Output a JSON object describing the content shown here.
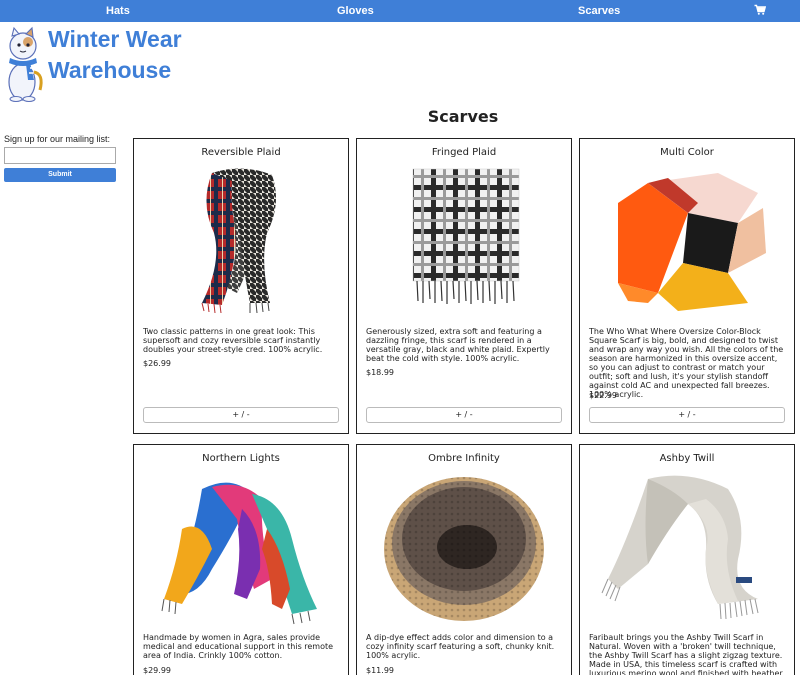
{
  "nav": {
    "items": [
      {
        "label": "Hats"
      },
      {
        "label": "Gloves"
      },
      {
        "label": "Scarves"
      }
    ],
    "cart_icon": "cart-icon",
    "color": "#3f7fd7"
  },
  "logo": {
    "line1": "Winter Wear",
    "line2": "Warehouse"
  },
  "signup": {
    "label": "Sign up for our mailing list:",
    "input_value": "",
    "submit_label": "Submit"
  },
  "page": {
    "title": "Scarves"
  },
  "products": [
    {
      "name": "Reversible Plaid",
      "description": "Two classic patterns in one great look: This supersoft and cozy reversible scarf instantly doubles your street-style cred. 100% acrylic.",
      "price": "$26.99",
      "qty_label": "+ / -"
    },
    {
      "name": "Fringed Plaid",
      "description": "Generously sized, extra soft and featuring a dazzling fringe, this scarf is rendered in a versatile gray, black and white plaid. Expertly beat the cold with style. 100% acrylic.",
      "price": "$18.99",
      "qty_label": "+ / -"
    },
    {
      "name": "Multi Color",
      "description": "The Who What Where Oversize Color-Block Square Scarf is big, bold, and designed to twist and wrap any way you wish. All the colors of the season are harmonized in this oversize accent, so you can adjust to contrast or match your outfit; soft and lush, it's your stylish standoff against cold AC and unexpected fall breezes. 100% acrylic.",
      "price": "$22.99",
      "qty_label": "+ / -"
    },
    {
      "name": "Northern Lights",
      "description": "Handmade by women in Agra, sales provide medical and educational support in this remote area of India. Crinkly 100% cotton.",
      "price": "$29.99",
      "qty_label": "+ / -"
    },
    {
      "name": "Ombre Infinity",
      "description": "A dip-dye effect adds color and dimension to a cozy infinity scarf featuring a soft, chunky knit. 100% acrylic.",
      "price": "$11.99",
      "qty_label": "+ / -"
    },
    {
      "name": "Ashby Twill",
      "description": "Faribault brings you the Ashby Twill Scarf in Natural. Woven with a 'broken' twill technique, the Ashby Twill Scarf has a slight zigzag texture. Made in USA, this timeless scarf is crafted with luxurious merino wool and finished with heather gray fringe. 100%",
      "price": "",
      "qty_label": "+ / -"
    }
  ]
}
